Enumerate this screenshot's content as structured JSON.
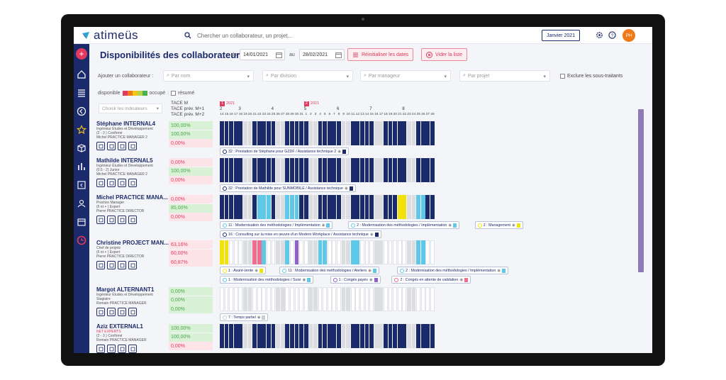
{
  "app": {
    "name": "atimeüs"
  },
  "search": {
    "placeholder": "Chercher un collaborateur, un projet..."
  },
  "header": {
    "month": "Janvier 2021",
    "avatar": "PH"
  },
  "page": {
    "title": "Disponibilités des collaborateurs",
    "from_label": "du",
    "from_date": "14/01/2021",
    "to_label": "au",
    "to_date": "28/02/2021",
    "reset_label": "Réinitialiser les dates",
    "clear_label": "Vider la liste"
  },
  "filters": {
    "add_label": "Ajouter un collaborateur :",
    "by_name": "Par nom",
    "by_division": "Par division",
    "by_manager": "Par manageur",
    "by_project": "Par projet",
    "exclude_label": "Exclure les sous-traitants"
  },
  "legend": {
    "available": "disponible",
    "busy": "occupé",
    "summary": "résumé",
    "scale": [
      "#e23a5c",
      "#f07a1a",
      "#f5c518",
      "#b6d44a",
      "#4caf50"
    ]
  },
  "indicators": {
    "placeholder": "Choisir les indicateurs",
    "tace": [
      "TACE M",
      "TACE prév. M+1",
      "TACE prév. M+2"
    ]
  },
  "calendar": {
    "years": [
      "2021",
      "2021"
    ],
    "weeks": [
      "2",
      "3",
      "4",
      "5",
      "6",
      "7",
      "8"
    ],
    "days_jan": [
      "14",
      "15",
      "16",
      "17",
      "18",
      "19",
      "20",
      "21",
      "22",
      "23",
      "24",
      "25",
      "26",
      "27",
      "28",
      "29",
      "30",
      "31"
    ],
    "days_feb": [
      "1",
      "2",
      "3",
      "4",
      "5",
      "6",
      "7",
      "8",
      "9",
      "10",
      "11",
      "12",
      "13",
      "14",
      "15",
      "16",
      "17",
      "18",
      "19",
      "20",
      "21",
      "22",
      "23",
      "24",
      "25",
      "26",
      "27",
      "28"
    ]
  },
  "colors": {
    "navy": "#1b2a6b",
    "free": "#ffffff",
    "weekend": "#dcdde1",
    "light_blue": "#5fc8e8",
    "yellow": "#f2e20c",
    "pink": "#ef6d8e",
    "purple": "#8e60c8"
  },
  "people": [
    {
      "name": "Stéphane INTERNAL4",
      "role": "Ingénieur Études et Développement",
      "level": "(2 - 3 ) Confirmé",
      "manager": "Michel PRACTICE MANAGER 2",
      "pcts": [
        {
          "v": "100,00%",
          "t": "g"
        },
        {
          "v": "100,00%",
          "t": "g"
        },
        {
          "v": "0,00%",
          "t": "r"
        }
      ],
      "pattern": "navy",
      "assignments": [
        {
          "label": "32 : Prestation de Stéphane pour GZDF / Assistance technique 2",
          "color": "#1b2a6b"
        }
      ]
    },
    {
      "name": "Mathilde INTERNAL5",
      "role": "Ingénieur Études et Développement",
      "level": "(0.5 - 2) Junior",
      "manager": "Michel PRACTICE MANAGER 2",
      "pcts": [
        {
          "v": "0,00%",
          "t": "r"
        },
        {
          "v": "100,00%",
          "t": "g"
        },
        {
          "v": "0,00%",
          "t": "r"
        }
      ],
      "pattern": "navy",
      "assignments": [
        {
          "label": "32 : Prestation de Mathilde pour SUNMOBILE / Assistance technique",
          "color": "#1b2a6b"
        }
      ]
    },
    {
      "name": "Michel PRACTICE MANA...",
      "role": "Practice Manager",
      "level": "(6 et + ) Expert",
      "manager": "Pierre PRACTICE DIRECTOR",
      "pcts": [
        {
          "v": "0,00%",
          "t": "r"
        },
        {
          "v": "85,00%",
          "t": "g"
        },
        {
          "v": "0,00%",
          "t": "r"
        }
      ],
      "pattern": "mixed",
      "assignments": [
        {
          "label": "11 : Modernisation des méthodologies / Implémentation",
          "color": "#5fc8e8"
        },
        {
          "label": "2 : Modernisation des méthodologies / Implémentation",
          "color": "#5fc8e8"
        },
        {
          "label": "2 : Management",
          "color": "#f2e20c"
        },
        {
          "label": "16 : Consulting sur la mise en œuvre d'un Modern Workplace / Assistance technique",
          "color": "#1b2a6b"
        }
      ]
    },
    {
      "name": "Christine PROJECT MAN...",
      "role": "Chef de projets",
      "level": "(6 et + ) Expert",
      "manager": "Pierre PRACTICE DIRECTOR",
      "pcts": [
        {
          "v": "63,16%",
          "t": "r"
        },
        {
          "v": "60,00%",
          "t": "r"
        },
        {
          "v": "60,87%",
          "t": "r"
        }
      ],
      "pattern": "christine",
      "assignments": [
        {
          "label": "1 : Avant-vente",
          "color": "#f2e20c"
        },
        {
          "label": "11 : Modernisation des méthodologies / Ateliers",
          "color": "#5fc8e8"
        },
        {
          "label": "2 : Modernisation des méthodologies / Implémentation",
          "color": "#5fc8e8"
        },
        {
          "label": "1 : Modernisation des méthodologies / Suivi",
          "color": "#5fc8e8"
        },
        {
          "label": "1 : Congés payés",
          "color": "#8e60c8"
        },
        {
          "label": "2 : Congés en attente de validation",
          "color": "#ef6d8e"
        }
      ]
    },
    {
      "name": "Margot ALTERNANT1",
      "role": "Ingénieur Études et Développement",
      "level": "Stagiaire",
      "manager": "Romain PRACTICE MANAGER",
      "pcts": [
        {
          "v": "0,00%",
          "t": "g"
        },
        {
          "v": "0,00%",
          "t": "g"
        },
        {
          "v": "0,00%",
          "t": "g"
        }
      ],
      "pattern": "free",
      "assignments": [
        {
          "label": "7 : Temps partiel",
          "color": "#cccccc"
        }
      ]
    },
    {
      "name": "Aziz EXTERNAL1",
      "role": "NET EXPERTS",
      "level": "(2 - 3 ) Confirmé",
      "manager": "Romain PRACTICE MANAGER",
      "pcts": [
        {
          "v": "100,00%",
          "t": "g"
        },
        {
          "v": "100,00%",
          "t": "g"
        },
        {
          "v": "0,00%",
          "t": "r"
        }
      ],
      "pattern": "navy",
      "assignments": []
    }
  ]
}
